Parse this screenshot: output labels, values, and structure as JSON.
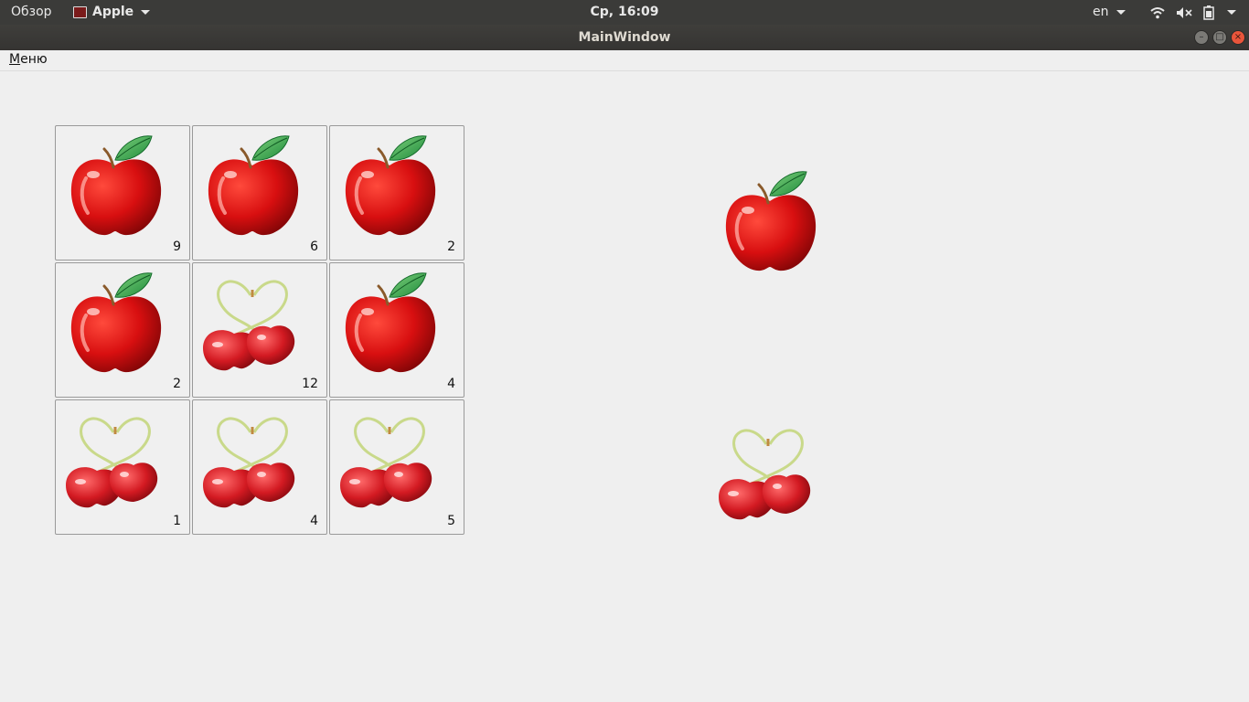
{
  "topbar": {
    "activities": "Обзор",
    "app_name": "Apple",
    "clock": "Ср, 16:09",
    "language": "en"
  },
  "window": {
    "title": "MainWindow"
  },
  "menubar": {
    "menu_first_letter": "М",
    "menu_rest": "еню"
  },
  "grid": [
    {
      "fruit": "apple",
      "count": "9"
    },
    {
      "fruit": "apple",
      "count": "6"
    },
    {
      "fruit": "apple",
      "count": "2"
    },
    {
      "fruit": "apple",
      "count": "2"
    },
    {
      "fruit": "cherry",
      "count": "12"
    },
    {
      "fruit": "apple",
      "count": "4"
    },
    {
      "fruit": "cherry",
      "count": "1"
    },
    {
      "fruit": "cherry",
      "count": "4"
    },
    {
      "fruit": "cherry",
      "count": "5"
    }
  ],
  "preview": {
    "top": "apple",
    "bottom": "cherry"
  }
}
